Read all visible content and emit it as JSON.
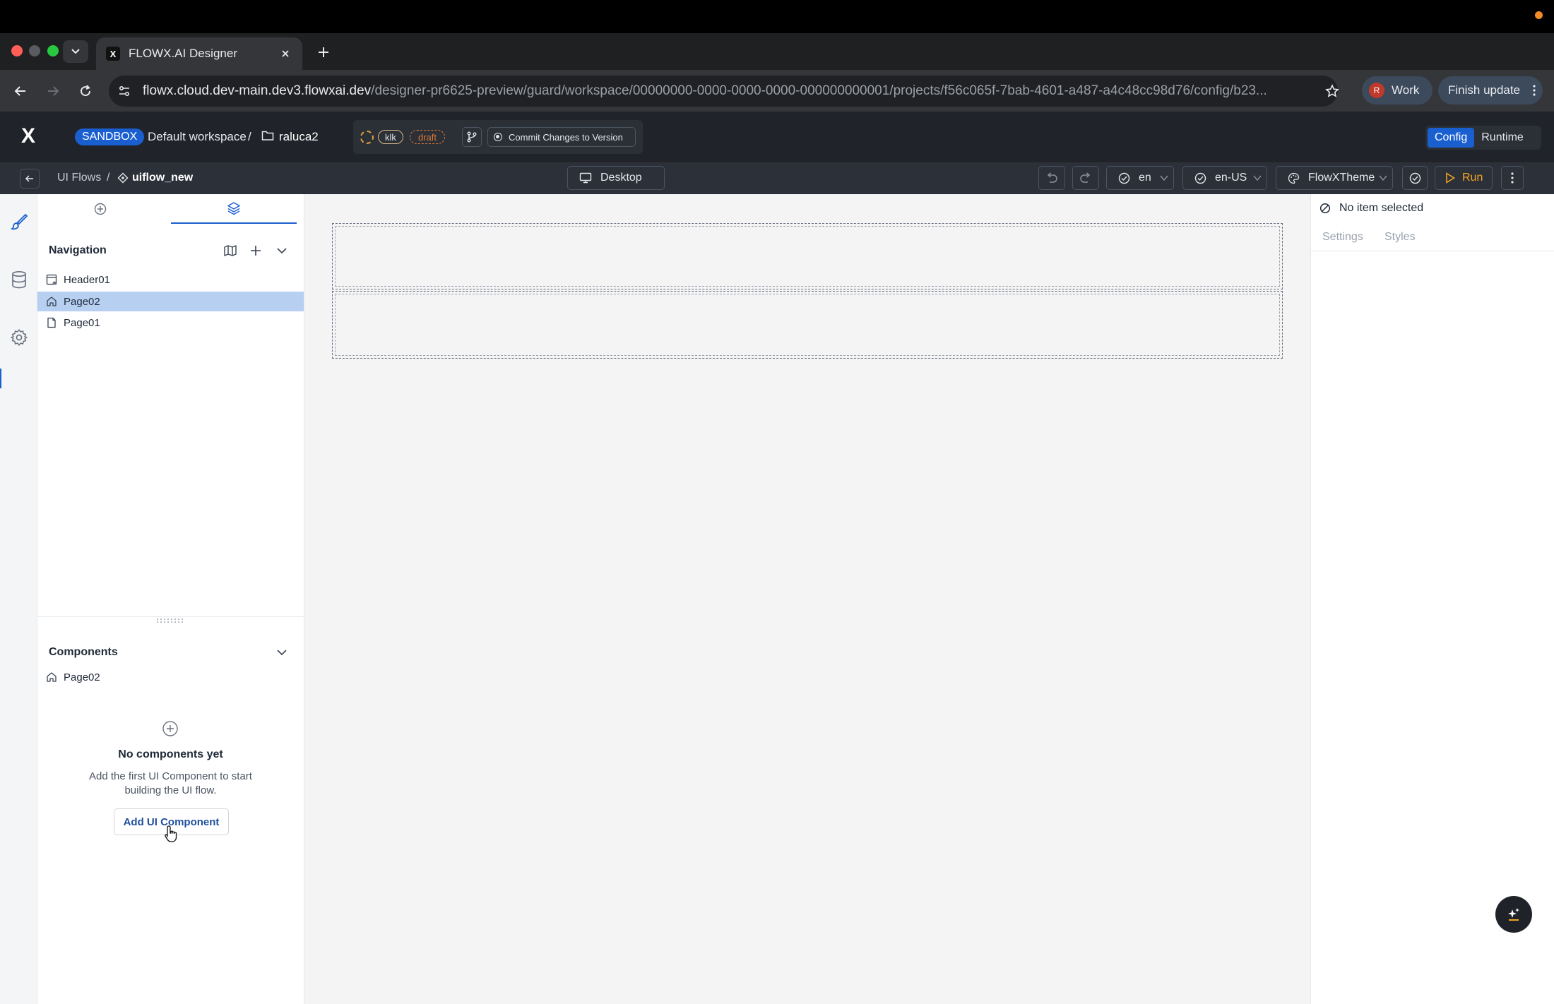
{
  "browser": {
    "tab_title": "FLOWX.AI Designer",
    "favicon_letter": "X",
    "url_host": "flowx.cloud.dev-main.dev3.flowxai.dev",
    "url_path": "/designer-pr6625-preview/guard/workspace/00000000-0000-0000-0000-000000000001/projects/f56c065f-7bab-4601-a487-a4c48cc98d76/config/b23...",
    "profile_initial": "R",
    "profile_label": "Work",
    "update_label": "Finish update"
  },
  "header": {
    "logo": "X",
    "env_badge": "SANDBOX",
    "workspace": "Default workspace",
    "separator": "/",
    "project": "raluca2",
    "version_name": "klk",
    "version_status": "draft",
    "commit_label": "Commit Changes to Version",
    "modes": [
      "Config",
      "Runtime"
    ],
    "active_mode": "Config"
  },
  "toolbar": {
    "breadcrumb_root": "UI Flows",
    "breadcrumb_sep": "/",
    "breadcrumb_current": "uiflow_new",
    "device": "Desktop",
    "language": "en",
    "locale": "en-US",
    "theme": "FlowXTheme",
    "run_label": "Run"
  },
  "left_panel": {
    "navigation_title": "Navigation",
    "nav_items": [
      {
        "label": "Header01",
        "icon": "header-page-icon"
      },
      {
        "label": "Page02",
        "icon": "home-icon",
        "selected": true
      },
      {
        "label": "Page01",
        "icon": "page-icon"
      }
    ],
    "components_title": "Components",
    "component_root": "Page02",
    "empty_title": "No components yet",
    "empty_description": "Add the first UI Component to start building the UI flow.",
    "add_button": "Add UI Component"
  },
  "right_panel": {
    "no_selection": "No item selected",
    "tabs": [
      "Settings",
      "Styles"
    ]
  },
  "colors": {
    "accent": "#1a5fd0",
    "header_bg": "#202329",
    "toolbar_bg": "#2c3038",
    "run": "#f5a623",
    "draft": "#e0783b",
    "selected_row": "#b7d0f2"
  }
}
